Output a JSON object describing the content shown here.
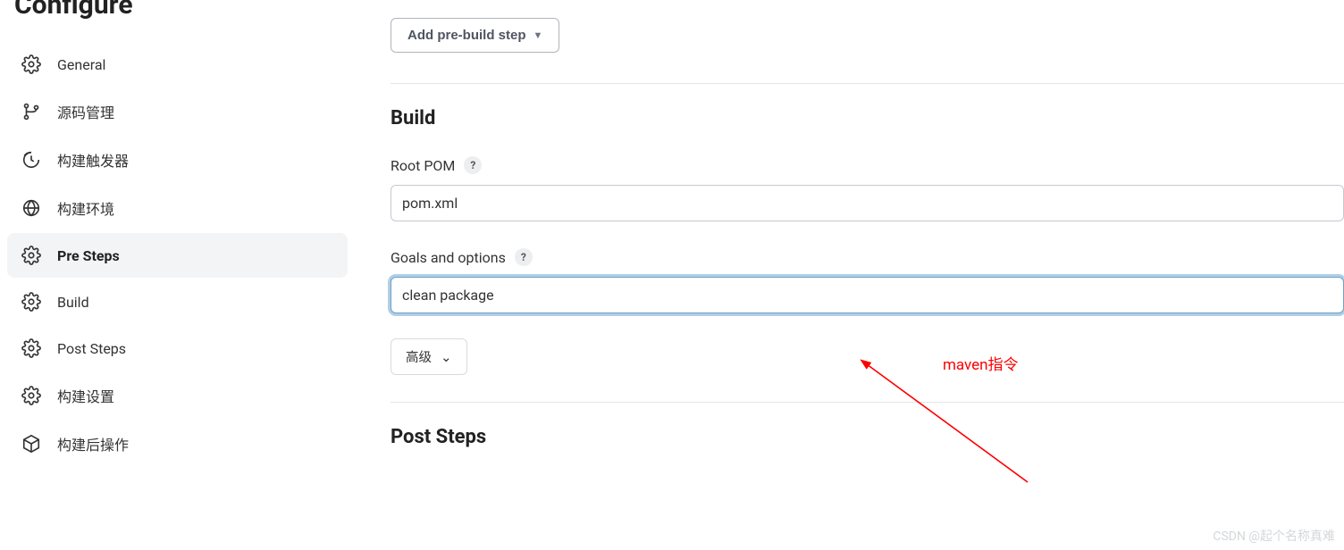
{
  "page_title": "Configure",
  "sidebar": {
    "items": [
      {
        "label": "General",
        "icon": "gear"
      },
      {
        "label": "源码管理",
        "icon": "branch"
      },
      {
        "label": "构建触发器",
        "icon": "clock"
      },
      {
        "label": "构建环境",
        "icon": "globe"
      },
      {
        "label": "Pre Steps",
        "icon": "gear",
        "active": true
      },
      {
        "label": "Build",
        "icon": "gear"
      },
      {
        "label": "Post Steps",
        "icon": "gear"
      },
      {
        "label": "构建设置",
        "icon": "gear"
      },
      {
        "label": "构建后操作",
        "icon": "package"
      }
    ]
  },
  "main": {
    "add_button": "Add pre-build step",
    "build_section": {
      "title": "Build",
      "root_pom_label": "Root POM",
      "root_pom_value": "pom.xml",
      "goals_label": "Goals and options",
      "goals_value": "clean package",
      "advanced_label": "高级"
    },
    "post_steps_title": "Post Steps",
    "annotation": "maven指令"
  },
  "help": "?",
  "watermark": "CSDN @起个名称真难"
}
